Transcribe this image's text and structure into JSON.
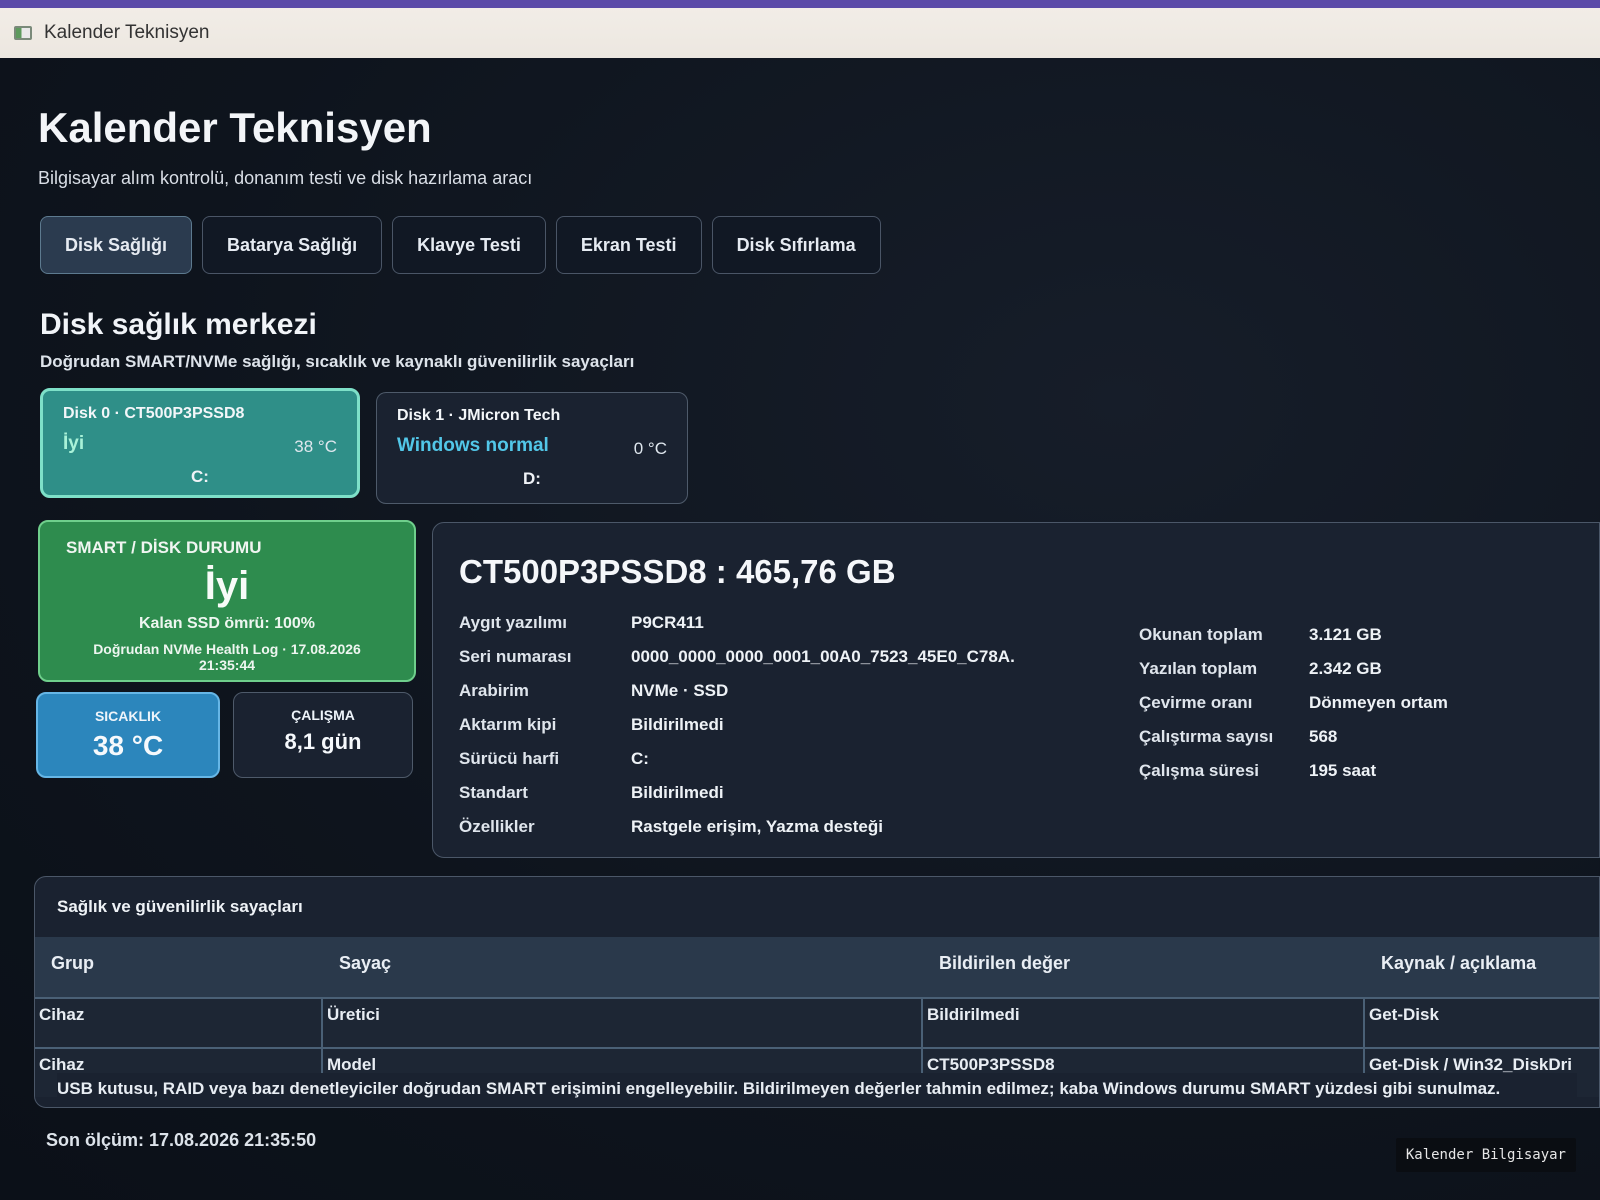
{
  "window": {
    "title": "Kalender Teknisyen"
  },
  "header": {
    "title": "Kalender Teknisyen",
    "subtitle": "Bilgisayar alım kontrolü, donanım testi ve disk hazırlama aracı"
  },
  "tabs": [
    {
      "label": "Disk Sağlığı",
      "active": true
    },
    {
      "label": "Batarya Sağlığı"
    },
    {
      "label": "Klavye Testi"
    },
    {
      "label": "Ekran Testi"
    },
    {
      "label": "Disk Sıfırlama"
    }
  ],
  "section": {
    "title": "Disk sağlık merkezi",
    "subtitle": "Doğrudan SMART/NVMe sağlığı, sıcaklık ve kaynaklı güvenilirlik sayaçları"
  },
  "disks": [
    {
      "title": "Disk 0 · CT500P3PSSD8",
      "status": "İyi",
      "temp": "38 °C",
      "drive": "C:"
    },
    {
      "title": "Disk 1 · JMicron Tech",
      "status": "Windows normal",
      "temp": "0 °C",
      "drive": "D:"
    }
  ],
  "smart": {
    "label": "SMART / DİSK DURUMU",
    "value": "İyi",
    "life": "Kalan SSD ömrü: 100%",
    "source": "Doğrudan NVMe Health Log · 17.08.2026 21:35:44"
  },
  "metrics": {
    "temp": {
      "label": "SICAKLIK",
      "value": "38 °C"
    },
    "uptime": {
      "label": "ÇALIŞMA",
      "value": "8,1 gün"
    }
  },
  "details": {
    "title": "CT500P3PSSD8 : 465,76 GB",
    "left": [
      {
        "k": "Aygıt yazılımı",
        "v": "P9CR411"
      },
      {
        "k": "Seri numarası",
        "v": "0000_0000_0000_0001_00A0_7523_45E0_C78A."
      },
      {
        "k": "Arabirim",
        "v": "NVMe · SSD"
      },
      {
        "k": "Aktarım kipi",
        "v": "Bildirilmedi"
      },
      {
        "k": "Sürücü harfi",
        "v": "C:"
      },
      {
        "k": "Standart",
        "v": "Bildirilmedi"
      },
      {
        "k": "Özellikler",
        "v": "Rastgele erişim, Yazma desteği"
      }
    ],
    "right": [
      {
        "k": "Okunan toplam",
        "v": "3.121 GB"
      },
      {
        "k": "Yazılan toplam",
        "v": "2.342 GB"
      },
      {
        "k": "Çevirme oranı",
        "v": "Dönmeyen ortam"
      },
      {
        "k": "Çalıştırma sayısı",
        "v": "568"
      },
      {
        "k": "Çalışma süresi",
        "v": "195 saat"
      }
    ]
  },
  "counters": {
    "title": "Sağlık ve güvenilirlik sayaçları",
    "columns": [
      "Grup",
      "Sayaç",
      "Bildirilen değer",
      "Kaynak / açıklama"
    ],
    "rows": [
      [
        "Cihaz",
        "Üretici",
        "Bildirilmedi",
        "Get-Disk"
      ],
      [
        "Cihaz",
        "Model",
        "CT500P3PSSD8",
        "Get-Disk / Win32_DiskDri"
      ]
    ],
    "note": "USB kutusu, RAID veya bazı denetleyiciler doğrudan SMART erişimini engelleyebilir. Bildirilmeyen değerler tahmin edilmez; kaba Windows durumu SMART yüzdesi gibi sunulmaz."
  },
  "footer": {
    "last_measure": "Son ölçüm: 17.08.2026 21:35:50",
    "badge": "Kalender Bilgisayar"
  }
}
